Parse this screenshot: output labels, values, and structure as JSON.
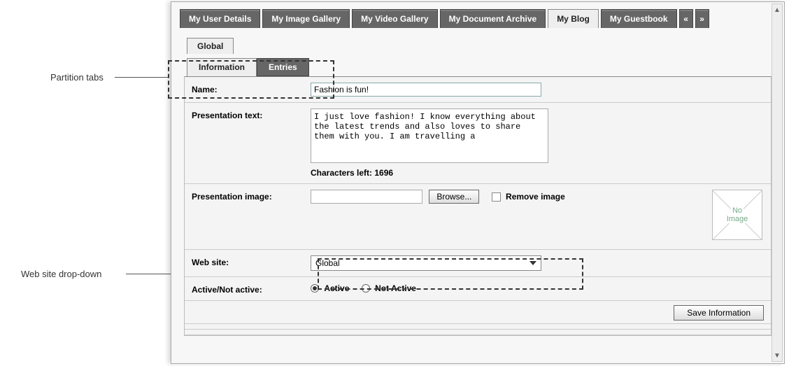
{
  "annotations": {
    "partition_tabs": "Partition tabs",
    "website_dropdown": "Web site drop-down"
  },
  "main_tabs": {
    "items": [
      "My User Details",
      "My Image Gallery",
      "My Video Gallery",
      "My Document Archive",
      "My Blog",
      "My Guestbook"
    ],
    "active_index": 4,
    "prev": "«",
    "next": "»"
  },
  "partition": {
    "global": "Global",
    "sub": [
      "Information",
      "Entries"
    ],
    "active_sub": 0
  },
  "form": {
    "name": {
      "label": "Name:",
      "value": "Fashion is fun!"
    },
    "presentation_text": {
      "label": "Presentation text:",
      "value": "I just love fashion! I know everything about the latest trends and also loves to share them with you. I am travelling a ",
      "chars_left_label": "Characters left: 1696"
    },
    "presentation_image": {
      "label": "Presentation image:",
      "browse": "Browse...",
      "remove": "Remove image",
      "no_image_line1": "No",
      "no_image_line2": "Image"
    },
    "website": {
      "label": "Web site:",
      "selected": "Global"
    },
    "active": {
      "label": "Active/Not active:",
      "option_active": "Active",
      "option_not_active": "Not Active",
      "selected": "active"
    },
    "save": "Save Information"
  }
}
